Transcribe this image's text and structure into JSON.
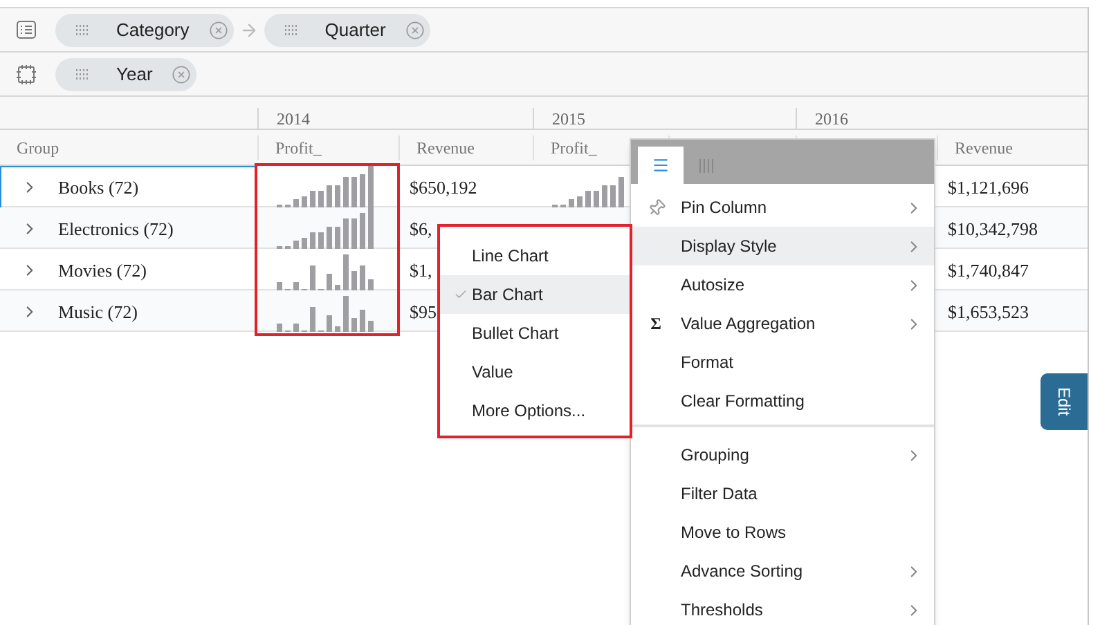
{
  "zones": [
    {
      "kind": "rows",
      "chips": [
        {
          "label": "Category"
        },
        {
          "label": "Quarter"
        }
      ]
    },
    {
      "kind": "columns",
      "chips": [
        {
          "label": "Year"
        }
      ]
    }
  ],
  "grid": {
    "years": [
      "2014",
      "2015",
      "2016"
    ],
    "columns": [
      "Group",
      "Profit_",
      "Revenue",
      "Profit_",
      "",
      "",
      "Revenue"
    ],
    "rows": [
      {
        "label": "Books (72)",
        "selected": true,
        "cells": [
          {
            "kind": "sparkline"
          },
          {
            "kind": "text",
            "text": "$650,192"
          },
          {
            "kind": "sparkline"
          },
          {
            "kind": "blank"
          },
          {
            "kind": "blank"
          },
          {
            "kind": "text",
            "text": "$1,121,696"
          }
        ]
      },
      {
        "label": "Electronics (72)",
        "selected": false,
        "cells": [
          {
            "kind": "sparkline"
          },
          {
            "kind": "text",
            "text": "$6,"
          },
          {
            "kind": "blank"
          },
          {
            "kind": "blank"
          },
          {
            "kind": "blank"
          },
          {
            "kind": "text",
            "text": "$10,342,798"
          }
        ]
      },
      {
        "label": "Movies (72)",
        "selected": false,
        "cells": [
          {
            "kind": "sparkline"
          },
          {
            "kind": "text",
            "text": "$1,"
          },
          {
            "kind": "blank"
          },
          {
            "kind": "blank"
          },
          {
            "kind": "blank"
          },
          {
            "kind": "text",
            "text": "$1,740,847"
          }
        ]
      },
      {
        "label": "Music (72)",
        "selected": false,
        "cells": [
          {
            "kind": "sparkline"
          },
          {
            "kind": "text",
            "text": "$95"
          },
          {
            "kind": "blank"
          },
          {
            "kind": "blank"
          },
          {
            "kind": "blank"
          },
          {
            "kind": "text",
            "text": "$1,653,523"
          }
        ]
      }
    ]
  },
  "column_menu": {
    "tabs": [
      {
        "kind": "menu",
        "selected": true
      },
      {
        "kind": "columns",
        "selected": false
      }
    ],
    "groups": [
      [
        {
          "label": "Pin Column",
          "kind": "pin",
          "submenu": true,
          "highlighted": false
        },
        {
          "label": "Display Style",
          "kind": "plain",
          "submenu": true,
          "highlighted": true
        },
        {
          "label": "Autosize",
          "kind": "plain",
          "submenu": true,
          "highlighted": false
        },
        {
          "label": "Value Aggregation",
          "kind": "symbol",
          "symbol": "Σ",
          "submenu": true,
          "highlighted": false
        },
        {
          "label": "Format",
          "kind": "plain",
          "submenu": false,
          "highlighted": false
        },
        {
          "label": "Clear Formatting",
          "kind": "plain",
          "submenu": false,
          "highlighted": false
        }
      ],
      [
        {
          "label": "Grouping",
          "kind": "plain",
          "submenu": true,
          "highlighted": false
        },
        {
          "label": "Filter Data",
          "kind": "plain",
          "submenu": false,
          "highlighted": false
        },
        {
          "label": "Move to Rows",
          "kind": "plain",
          "submenu": false,
          "highlighted": false
        },
        {
          "label": "Advance Sorting",
          "kind": "plain",
          "submenu": true,
          "highlighted": false
        },
        {
          "label": "Thresholds",
          "kind": "plain",
          "submenu": true,
          "highlighted": false
        }
      ]
    ]
  },
  "display_style_menu": {
    "items": [
      {
        "label": "Line Chart",
        "selected": false
      },
      {
        "label": "Bar Chart",
        "selected": true
      },
      {
        "label": "Bullet Chart",
        "selected": false
      },
      {
        "label": "Value",
        "selected": false
      },
      {
        "label": "More Options...",
        "selected": false
      }
    ]
  },
  "edit_tab": {
    "label": "Edit"
  }
}
